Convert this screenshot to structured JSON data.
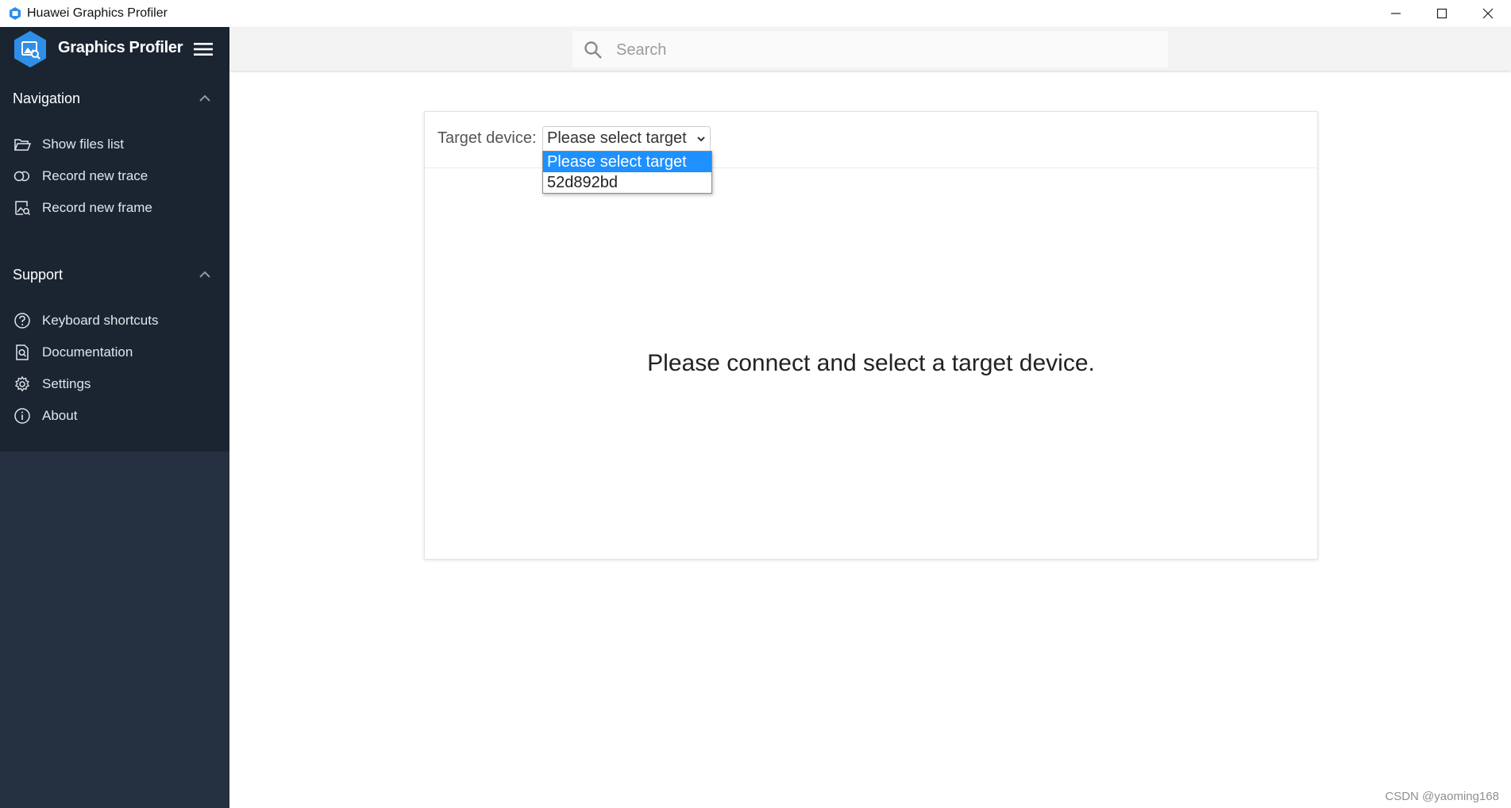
{
  "window": {
    "title": "Huawei Graphics Profiler",
    "controls": [
      "minimize-icon",
      "maximize-icon",
      "close-icon"
    ]
  },
  "sidebar": {
    "brand": "Graphics Profiler",
    "sections": [
      {
        "title": "Navigation",
        "items": [
          {
            "label": "Show files list",
            "icon": "folder-open-icon"
          },
          {
            "label": "Record new trace",
            "icon": "record-trace-icon"
          },
          {
            "label": "Record new frame",
            "icon": "record-frame-icon"
          }
        ]
      },
      {
        "title": "Support",
        "items": [
          {
            "label": "Keyboard shortcuts",
            "icon": "question-circle-icon"
          },
          {
            "label": "Documentation",
            "icon": "document-search-icon"
          },
          {
            "label": "Settings",
            "icon": "gear-icon"
          },
          {
            "label": "About",
            "icon": "info-circle-icon"
          }
        ]
      }
    ]
  },
  "search": {
    "placeholder": "Search"
  },
  "target": {
    "label": "Target device:",
    "selected": "Please select target",
    "options": [
      "Please select target",
      "52d892bd"
    ]
  },
  "main": {
    "message": "Please connect and select a target device."
  },
  "watermark": "CSDN @yaoming168",
  "colors": {
    "sidebar_bg": "#253140",
    "sidebar_panel": "#1b2531",
    "accent": "#1e90ff",
    "logo_blue": "#2f8fe8"
  }
}
